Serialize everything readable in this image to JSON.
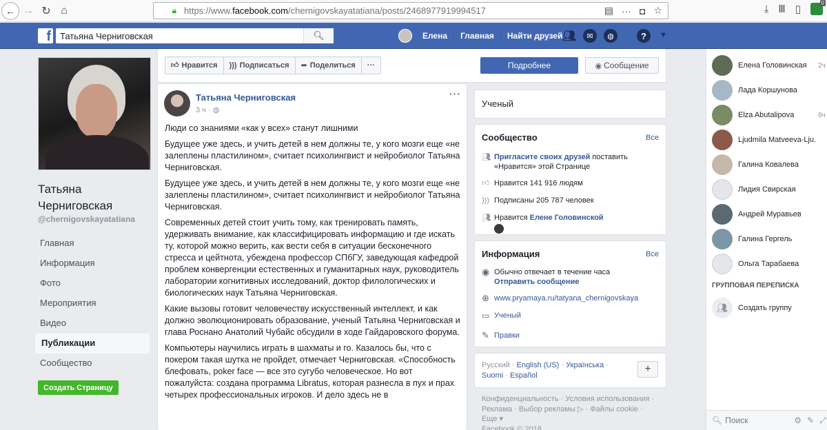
{
  "browser": {
    "url_prefix": "https://www.",
    "url_domain": "facebook.com",
    "url_path": "/chernigovskayatatiana/posts/2468977919994517",
    "ext_badge": "0"
  },
  "fb": {
    "logo": "f",
    "search_value": "Татьяна Черниговская",
    "user_name": "Елена",
    "nav_home": "Главная",
    "nav_find_friends": "Найти друзей"
  },
  "page": {
    "name": "Татьяна Черниговская",
    "handle": "@chernigovskayatatiana",
    "nav": [
      "Главная",
      "Информация",
      "Фото",
      "Мероприятия",
      "Видео",
      "Публикации",
      "Сообщество"
    ],
    "create_page": "Создать Страницу"
  },
  "actions": {
    "like": "Нравится",
    "subscribe": "Подписаться",
    "share": "Поделиться",
    "more_dots": "···",
    "details": "Подробнее",
    "message": "Сообщение"
  },
  "post": {
    "author": "Татьяна Черниговская",
    "time": "3 ч",
    "paragraphs": [
      "Люди со знаниями «как у всех» станут лишними",
      "Будущее уже здесь, и учить детей в нем должны те, у кого мозги еще «не залеплены пластилином», считает психолингвист и нейробиолог Татьяна Черниговская.",
      "Будущее уже здесь, и учить детей в нем должны те, у кого мозги еще «не залеплены пластилином», считает психолингвист и нейробиолог Татьяна Черниговская.",
      "Современных детей стоит учить тому, как тренировать память, удерживать внимание, как классифицировать информацию и где искать ту, которой можно верить, как вести себя в ситуации бесконечного стресса и цейтнота, убеждена профессор СПбГУ, заведующая кафедрой проблем конвергенции естественных и гуманитарных наук, руководитель лаборатории когнитивных исследований, доктор филологических и биологических наук Татьяна Черниговская.",
      "Какие вызовы готовит человечеству искусственный интеллект, и как должно эволюционировать образование, ученый Татьяна Черниговская и глава Роснано Анатолий Чубайс обсудили в ходе Гайдаровского форума.",
      "Компьютеры научились играть в шахматы и го. Казалось бы, что с покером такая шутка не пройдет, отмечает Черниговская. «Способность блефовать, poker face — все это сугубо человеческое. Но вот пожалуйста: создана программа Libratus, которая разнесла в пух и прах четырех профессиональных игроков. И дело здесь не в"
    ]
  },
  "category": "Ученый",
  "community": {
    "title": "Сообщество",
    "all": "Все",
    "invite_link": "Пригласите своих друзей",
    "invite_rest": " поставить «Нравится» этой Странице",
    "likes": "Нравится 141 916 людям",
    "followers": "Подписаны 205 787 человек",
    "liked_by_prefix": "Нравится ",
    "liked_by_name": "Елене Головинской"
  },
  "info": {
    "title": "Информация",
    "all": "Все",
    "response": "Обычно отвечает в течение часа",
    "send_message": "Отправить сообщение",
    "website": "www.pryamaya.ru/tatyana_chernigovskaya",
    "category": "Ученый",
    "edits": "Правки"
  },
  "languages": {
    "current": "Русский",
    "others": [
      "English (US)",
      "Українська",
      "Suomi",
      "Español"
    ]
  },
  "footer": {
    "text1": "Конфиденциальность · Условия использования ·",
    "text2": "Реклама · Выбор рекламы ▷ · Файлы cookie ·",
    "text3": "Еще ▾",
    "text4": "Facebook © 2018"
  },
  "chat": {
    "contacts": [
      {
        "name": "Елена Головинская",
        "time": "2ч",
        "color": "#5d6b57"
      },
      {
        "name": "Лада Коршунова",
        "time": "",
        "color": "#a6b7c6"
      },
      {
        "name": "Elza Abutalipova",
        "time": "8ч",
        "color": "#7a8c65"
      },
      {
        "name": "Ljudmila Matveeva-Lju...",
        "time": "",
        "color": "#8c5a4b"
      },
      {
        "name": "Галина Ковалева",
        "time": "",
        "color": "#c6b8a8"
      },
      {
        "name": "Лидия Свирская",
        "time": "",
        "color": "#e4e6ea"
      },
      {
        "name": "Андрей Муравьев",
        "time": "",
        "color": "#5a6a70"
      },
      {
        "name": "Галина Гергель",
        "time": "",
        "color": "#7c96a8"
      },
      {
        "name": "Ольга Тарабаева",
        "time": "",
        "color": "#e4e6ea"
      }
    ],
    "group_header": "ГРУППОВАЯ ПЕРЕПИСКА",
    "create_group": "Создать группу",
    "search_placeholder": "Поиск"
  }
}
